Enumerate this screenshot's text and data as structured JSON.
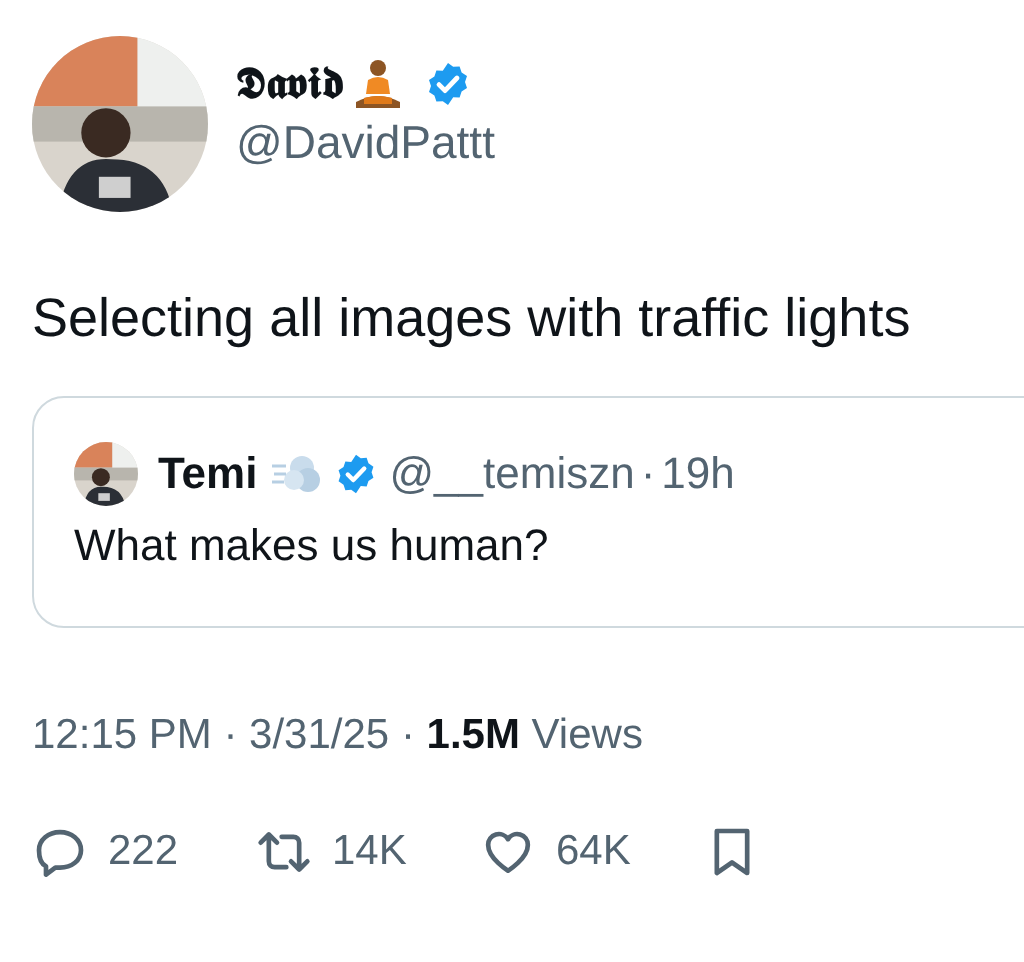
{
  "author": {
    "name": "𝕯𝖆𝖛𝖎𝖉",
    "verified": true,
    "handle": "@DavidPattt"
  },
  "text": "Selecting all images with traffic lights",
  "quote": {
    "name": "Temi",
    "verified": true,
    "handle": "@__temiszn",
    "separator": "·",
    "time": "19h",
    "text": "What makes us human?"
  },
  "meta": "12:15 PM · 3/31/25 · **1.5M** Views",
  "actions": [
    {
      "kind": "reply",
      "count": "222"
    },
    {
      "kind": "repost",
      "count": "14K"
    },
    {
      "kind": "like",
      "count": "64K"
    },
    {
      "kind": "bookmark"
    }
  ]
}
